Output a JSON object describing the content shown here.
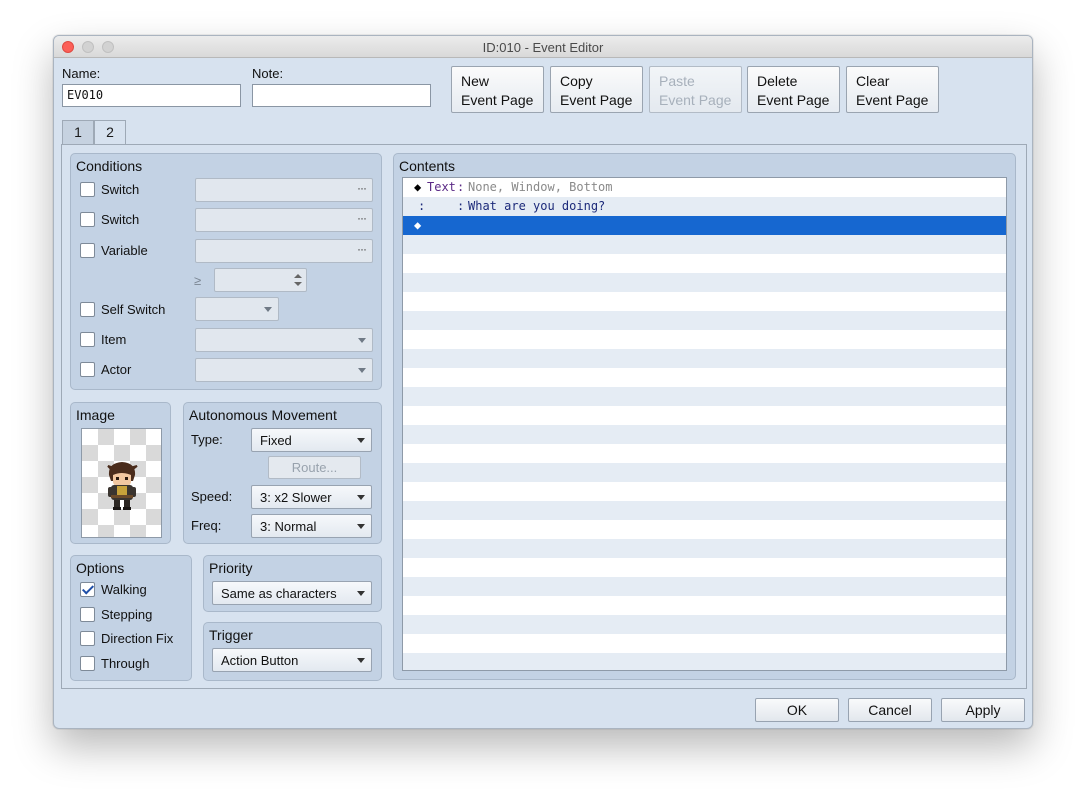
{
  "window": {
    "title": "ID:010 - Event Editor"
  },
  "header": {
    "name_label": "Name:",
    "name_value": "EV010",
    "note_label": "Note:",
    "note_value": "",
    "buttons": [
      {
        "line1": "New",
        "line2": "Event Page",
        "enabled": true
      },
      {
        "line1": "Copy",
        "line2": "Event Page",
        "enabled": true
      },
      {
        "line1": "Paste",
        "line2": "Event Page",
        "enabled": false
      },
      {
        "line1": "Delete",
        "line2": "Event Page",
        "enabled": true
      },
      {
        "line1": "Clear",
        "line2": "Event Page",
        "enabled": true
      }
    ]
  },
  "tabs": [
    {
      "label": "1",
      "active": false
    },
    {
      "label": "2",
      "active": true
    }
  ],
  "conditions": {
    "title": "Conditions",
    "switch1_label": "Switch",
    "switch2_label": "Switch",
    "variable_label": "Variable",
    "gte_symbol": "≥",
    "self_switch_label": "Self Switch",
    "item_label": "Item",
    "actor_label": "Actor",
    "ellipsis": "···"
  },
  "image": {
    "title": "Image",
    "character": "hero-sprite"
  },
  "movement": {
    "title": "Autonomous Movement",
    "type_label": "Type:",
    "type_value": "Fixed",
    "route_label": "Route...",
    "speed_label": "Speed:",
    "speed_value": "3: x2 Slower",
    "freq_label": "Freq:",
    "freq_value": "3: Normal"
  },
  "options": {
    "title": "Options",
    "walking_label": "Walking",
    "walking_checked": true,
    "stepping_label": "Stepping",
    "direction_fix_label": "Direction Fix",
    "through_label": "Through"
  },
  "priority": {
    "title": "Priority",
    "value": "Same as characters"
  },
  "trigger": {
    "title": "Trigger",
    "value": "Action Button"
  },
  "contents": {
    "title": "Contents",
    "rows": [
      {
        "marker": "◆",
        "command": "Text",
        "sep": ":",
        "params": "None, Window, Bottom"
      },
      {
        "marker": ":",
        "command": "",
        "sep": ":",
        "params": "What are you doing?"
      },
      {
        "marker": "◆",
        "command": "",
        "sep": "",
        "params": "",
        "selected": true
      }
    ]
  },
  "footer": {
    "ok": "OK",
    "cancel": "Cancel",
    "apply": "Apply"
  },
  "colors": {
    "selection": "#1667d0",
    "command_purple": "#5b2a86",
    "message_navy": "#1c2a7a",
    "params_gray": "#8a8a8a"
  }
}
